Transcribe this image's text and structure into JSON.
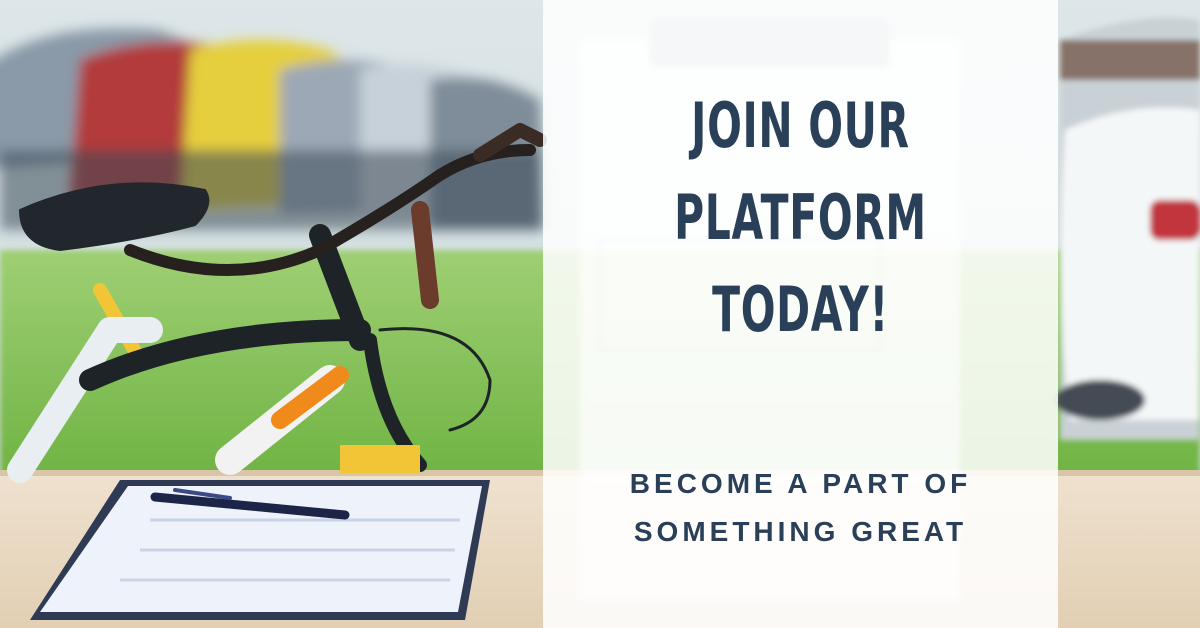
{
  "headline": {
    "line1": "JOIN OUR",
    "line2": "PLATFORM",
    "line3": "TODAY!"
  },
  "subheadline": {
    "line1": "BECOME A PART OF",
    "line2": "SOMETHING GREAT"
  },
  "colors": {
    "text": "#2a3f58",
    "panel": "#ffffff",
    "grass": "#7bbf4e",
    "table": "#e9d9c3"
  },
  "icons": [
    "bicycle",
    "clipboard",
    "pen",
    "parked-cars"
  ]
}
